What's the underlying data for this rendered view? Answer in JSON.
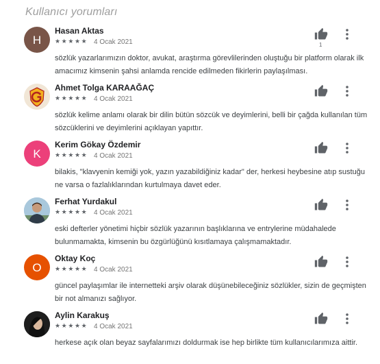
{
  "section_title": "Kullanıcı yorumları",
  "reviews": [
    {
      "name": "Hasan Aktas",
      "stars": "★★★★★",
      "rating": 5,
      "date": "4 Ocak 2021",
      "text": "sözlük yazarlarımızın doktor, avukat, araştırma görevlilerinden oluştuğu bir platform olarak ilk amacımız kimsenin şahsi anlamda rencide edilmeden fikirlerin paylaşılması.",
      "avatar_letter": "H",
      "avatar_color": "#795548",
      "helpful_count": "1"
    },
    {
      "name": "Ahmet Tolga KARAAĞAÇ",
      "stars": "★★★★★",
      "rating": 5,
      "date": "4 Ocak 2021",
      "text": "sözlük kelime anlamı olarak bir dilin bütün sözcük ve deyimlerini, belli bir çağda kullanılan tüm sözcüklerini ve deyimlerini açıklayan yapıttır.",
      "avatar_icon": "galatasaray-logo-icon"
    },
    {
      "name": "Kerim Gökay Özdemir",
      "stars": "★★★★★",
      "rating": 5,
      "date": "4 Ocak 2021",
      "text": "bilakis, \"klavyenin kemiği yok, yazın yazabildiğiniz kadar\" der, herkesi heybesine atıp sustuğu ne varsa o fazlalıklarından kurtulmaya davet eder.",
      "avatar_letter": "K",
      "avatar_color": "#ec407a"
    },
    {
      "name": "Ferhat Yurdakul",
      "stars": "★★★★★",
      "rating": 5,
      "date": "4 Ocak 2021",
      "text": "eski defterler yönetimi hiçbir sözlük yazarının başlıklarına ve entrylerine müdahalede bulunmamakta, kimsenin bu özgürlüğünü kısıtlamaya çalışmamaktadır.",
      "avatar_icon": "user-photo-icon"
    },
    {
      "name": "Oktay Koç",
      "stars": "★★★★★",
      "rating": 5,
      "date": "4 Ocak 2021",
      "text": "güncel paylaşımlar ile internetteki arşiv olarak düşünebileceğiniz sözlükler, sizin de geçmişten bir not almanızı sağlıyor.",
      "avatar_letter": "O",
      "avatar_color": "#e65100"
    },
    {
      "name": "Aylin Karakuş",
      "stars": "★★★★★",
      "rating": 5,
      "date": "4 Ocak 2021",
      "text": "herkese açık olan beyaz sayfalarımızı doldurmak ise hep birlikte tüm kullanıcılarımıza aittir.",
      "avatar_icon": "user-photo-icon"
    }
  ],
  "icons": {
    "helpful": "thumb-up-icon",
    "more": "more-vert-icon"
  }
}
